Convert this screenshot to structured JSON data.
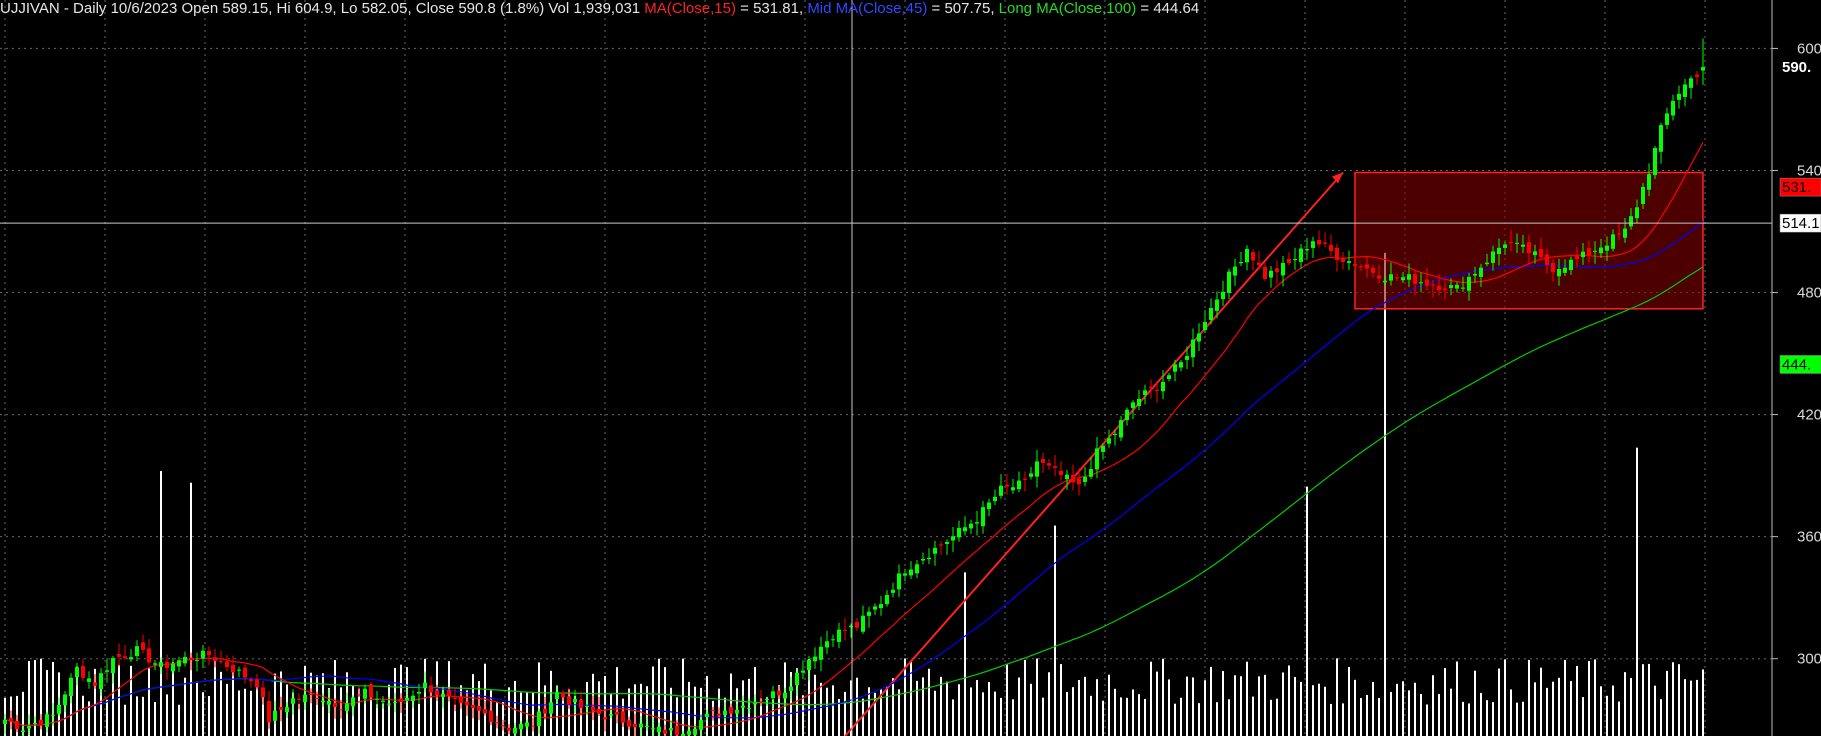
{
  "header": {
    "symbol_line": "UJJIVAN - Daily 10/6/2023 Open 589.15, Hi 604.9, Lo 582.05, Close 590.8 (1.8%) Vol 1,939,031 ",
    "ma_short_label": "MA(Close,15)",
    "ma_short_value": " = 531.81, ",
    "ma_mid_label": "Mid MA(Close,45)",
    "ma_mid_value": " = 507.75, ",
    "ma_long_label": "Long MA(Close,100)",
    "ma_long_value": " = 444.64"
  },
  "chart_data": {
    "type": "candlestick",
    "symbol": "UJJIVAN",
    "interval": "Daily",
    "date": "10/6/2023",
    "last_bar": {
      "open": 589.15,
      "high": 604.9,
      "low": 582.05,
      "close": 590.8,
      "change_pct": 1.8,
      "volume": 1939031
    },
    "ylim": [
      262,
      612
    ],
    "y_ticks": [
      300,
      360,
      420,
      480,
      540,
      600
    ],
    "y_tick_labels": [
      "300",
      "360",
      "420",
      "480",
      "540",
      "600"
    ],
    "price_tags": [
      {
        "label": "590.",
        "value": 590.8,
        "color": "#000000",
        "text_color": "#ffffff"
      },
      {
        "label": "531.",
        "value": 531.81,
        "color": "#ff0000",
        "text_color": "#000000"
      },
      {
        "label": "514.1",
        "value": 514.1,
        "color": "#ffffff",
        "text_color": "#000000"
      },
      {
        "label": "444.",
        "value": 444.64,
        "color": "#00ff00",
        "text_color": "#000000"
      }
    ],
    "crosshair_price": 514.1,
    "colors": {
      "up": "#00ff00",
      "down": "#ff0000",
      "ma_short": "#ff0000",
      "ma_mid": "#0000ff",
      "ma_long": "#00cc00",
      "volume": "#ffffff",
      "grid": "#666666"
    },
    "annotations": {
      "arrow": {
        "from_price": 262,
        "to_price": 539
      },
      "box": {
        "top": 539,
        "bottom": 472
      }
    },
    "anchors": [
      [
        0,
        270
      ],
      [
        3,
        266
      ],
      [
        8,
        272
      ],
      [
        12,
        295
      ],
      [
        15,
        288
      ],
      [
        18,
        300
      ],
      [
        22,
        304
      ],
      [
        26,
        296
      ],
      [
        30,
        300
      ],
      [
        34,
        302
      ],
      [
        38,
        295
      ],
      [
        42,
        288
      ],
      [
        44,
        270
      ],
      [
        48,
        280
      ],
      [
        52,
        282
      ],
      [
        56,
        277
      ],
      [
        60,
        283
      ],
      [
        65,
        277
      ],
      [
        70,
        287
      ],
      [
        76,
        276
      ],
      [
        80,
        273
      ],
      [
        84,
        266
      ],
      [
        88,
        268
      ],
      [
        92,
        283
      ],
      [
        96,
        276
      ],
      [
        100,
        272
      ],
      [
        104,
        269
      ],
      [
        108,
        265
      ],
      [
        112,
        264
      ],
      [
        115,
        268
      ],
      [
        118,
        273
      ],
      [
        122,
        276
      ],
      [
        126,
        280
      ],
      [
        130,
        285
      ],
      [
        134,
        300
      ],
      [
        138,
        312
      ],
      [
        142,
        316
      ],
      [
        146,
        328
      ],
      [
        150,
        344
      ],
      [
        154,
        352
      ],
      [
        158,
        360
      ],
      [
        162,
        369
      ],
      [
        166,
        383
      ],
      [
        170,
        386
      ],
      [
        172,
        397
      ],
      [
        176,
        390
      ],
      [
        179,
        384
      ],
      [
        182,
        401
      ],
      [
        185,
        411
      ],
      [
        188,
        426
      ],
      [
        192,
        434
      ],
      [
        196,
        445
      ],
      [
        200,
        467
      ],
      [
        204,
        488
      ],
      [
        207,
        502
      ],
      [
        210,
        488
      ],
      [
        214,
        494
      ],
      [
        218,
        506
      ],
      [
        222,
        498
      ],
      [
        226,
        493
      ],
      [
        230,
        488
      ],
      [
        234,
        487
      ],
      [
        238,
        484
      ],
      [
        242,
        482
      ],
      [
        246,
        493
      ],
      [
        250,
        505
      ],
      [
        254,
        500
      ],
      [
        258,
        492
      ],
      [
        262,
        496
      ],
      [
        266,
        503
      ],
      [
        270,
        510
      ],
      [
        272,
        523
      ],
      [
        274,
        540
      ],
      [
        276,
        560
      ],
      [
        278,
        575
      ],
      [
        280,
        582
      ],
      [
        283,
        590.8
      ]
    ],
    "volume_ylim": [
      0,
      850000
    ],
    "volume_spikes": [
      {
        "bar": 26,
        "value": 340000
      },
      {
        "bar": 31,
        "value": 325000
      },
      {
        "bar": 230,
        "value": 620000
      },
      {
        "bar": 217,
        "value": 320000
      },
      {
        "bar": 272,
        "value": 370000
      },
      {
        "bar": 175,
        "value": 270000
      },
      {
        "bar": 160,
        "value": 210000
      }
    ]
  }
}
